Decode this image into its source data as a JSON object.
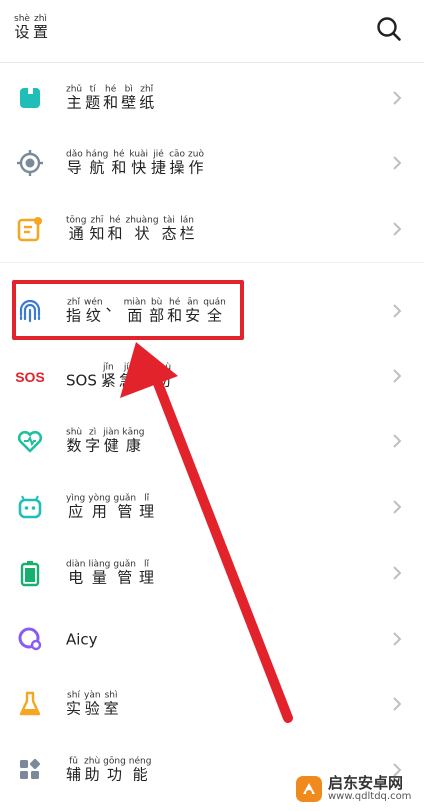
{
  "header": {
    "title": [
      {
        "py": "shè",
        "hz": "设"
      },
      {
        "py": "zhì",
        "hz": "置"
      }
    ],
    "search_icon": "search-icon"
  },
  "items": [
    {
      "key": "theme",
      "icon": "theme-icon",
      "color": "#1fbfb8",
      "ruby": [
        {
          "py": "zhǔ",
          "hz": "主"
        },
        {
          "py": "tí",
          "hz": "题"
        },
        {
          "py": "hé",
          "hz": "和"
        },
        {
          "py": "bì",
          "hz": "壁"
        },
        {
          "py": "zhǐ",
          "hz": "纸"
        }
      ]
    },
    {
      "key": "navigation",
      "icon": "navigation-icon",
      "color": "#7b8a9a",
      "ruby": [
        {
          "py": "dǎo",
          "hz": "导"
        },
        {
          "py": "háng",
          "hz": "航"
        },
        {
          "py": "hé",
          "hz": "和"
        },
        {
          "py": "kuài",
          "hz": "快"
        },
        {
          "py": "jié",
          "hz": "捷"
        },
        {
          "py": "cāo",
          "hz": "操"
        },
        {
          "py": "zuò",
          "hz": "作"
        }
      ]
    },
    {
      "key": "notification",
      "icon": "notification-icon",
      "color": "#f5a623",
      "ruby": [
        {
          "py": "tōng",
          "hz": "通"
        },
        {
          "py": "zhī",
          "hz": "知"
        },
        {
          "py": "hé",
          "hz": "和"
        },
        {
          "py": "zhuàng",
          "hz": "状"
        },
        {
          "py": "tài",
          "hz": "态"
        },
        {
          "py": "lán",
          "hz": "栏"
        }
      ]
    },
    {
      "key": "fingerprint",
      "icon": "fingerprint-icon",
      "color": "#3a7bd5",
      "ruby": [
        {
          "py": "zhǐ",
          "hz": "指"
        },
        {
          "py": "wén",
          "hz": "纹"
        },
        {
          "py": "",
          "hz": "、"
        },
        {
          "py": "miàn",
          "hz": "面"
        },
        {
          "py": "bù",
          "hz": "部"
        },
        {
          "py": "hé",
          "hz": "和"
        },
        {
          "py": "ān",
          "hz": "安"
        },
        {
          "py": "quán",
          "hz": "全"
        }
      ]
    },
    {
      "key": "sos",
      "icon": "sos-icon",
      "icon_text": "SOS",
      "color": "#e3232c",
      "prefix": "SOS",
      "ruby": [
        {
          "py": "jǐn",
          "hz": "紧"
        },
        {
          "py": "jí",
          "hz": "急"
        },
        {
          "py": "qiú",
          "hz": "求"
        },
        {
          "py": "zhù",
          "hz": "助"
        }
      ]
    },
    {
      "key": "digital-health",
      "icon": "heart-health-icon",
      "color": "#1fbfa0",
      "ruby": [
        {
          "py": "shù",
          "hz": "数"
        },
        {
          "py": "zì",
          "hz": "字"
        },
        {
          "py": "jiàn",
          "hz": "健"
        },
        {
          "py": "kāng",
          "hz": "康"
        }
      ]
    },
    {
      "key": "apps",
      "icon": "android-icon",
      "color": "#1fbfb8",
      "ruby": [
        {
          "py": "yìng",
          "hz": "应"
        },
        {
          "py": "yòng",
          "hz": "用"
        },
        {
          "py": "guǎn",
          "hz": "管"
        },
        {
          "py": "lǐ",
          "hz": "理"
        }
      ]
    },
    {
      "key": "battery",
      "icon": "battery-icon",
      "color": "#16b070",
      "ruby": [
        {
          "py": "diàn",
          "hz": "电"
        },
        {
          "py": "liàng",
          "hz": "量"
        },
        {
          "py": "guǎn",
          "hz": "管"
        },
        {
          "py": "lǐ",
          "hz": "理"
        }
      ]
    },
    {
      "key": "aicy",
      "icon": "aicy-icon",
      "color": "#8a5cf6",
      "plain": "Aicy"
    },
    {
      "key": "lab",
      "icon": "flask-icon",
      "color": "#f5a623",
      "ruby": [
        {
          "py": "shí",
          "hz": "实"
        },
        {
          "py": "yàn",
          "hz": "验"
        },
        {
          "py": "shì",
          "hz": "室"
        }
      ]
    },
    {
      "key": "accessibility",
      "icon": "grid-icon",
      "color": "#7b8a9a",
      "ruby": [
        {
          "py": "fǔ",
          "hz": "辅"
        },
        {
          "py": "zhù",
          "hz": "助"
        },
        {
          "py": "gōng",
          "hz": "功"
        },
        {
          "py": "néng",
          "hz": "能"
        }
      ]
    }
  ],
  "watermark": {
    "name": "启东安卓网",
    "url": "www.qdltdq.com"
  },
  "colors": {
    "highlight": "#e3232c",
    "chevron": "#bfbfbf"
  }
}
